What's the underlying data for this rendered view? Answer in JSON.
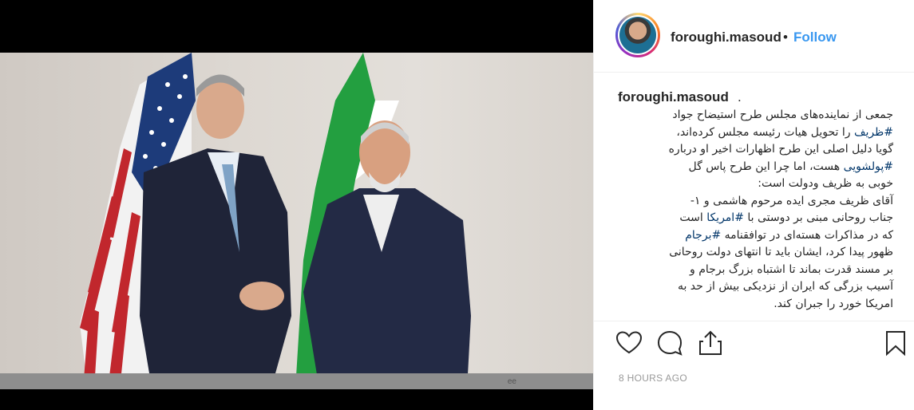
{
  "photo": {
    "watermark": "ee"
  },
  "header": {
    "username": "foroughi.masoud",
    "separator": "•",
    "follow_label": "Follow"
  },
  "caption": {
    "username": "foroughi.masoud",
    "trailing": ".",
    "lines": [
      "جمعی از نماینده‌های مجلس طرح استیضاح جواد",
      "#ظریف را تحویل هیات رئیسه مجلس کرده‌اند،",
      "گویا دلیل اصلی این طرح اظهارات اخیر او درباره",
      "#پولشویی هست، اما چرا این طرح پاس گل",
      "خوبی به ظریف ودولت است:",
      "آقای ظریف مجری ایده مرحوم هاشمی و ۱-",
      "جناب روحانی مبنی بر دوستی با #امریکا است",
      "که در مذاکرات هسته‌ای در توافقنامه  #برجام",
      "ظهور پیدا کرد، ایشان باید تا انتهای دولت روحانی",
      "بر مسند قدرت بماند تا اشتباه بزرگ برجام و",
      "آسیب بزرگی که ایران از نزدیکی بیش از حد به",
      "امریکا خورد را جبران کند."
    ]
  },
  "actions": {
    "like": "heart-icon",
    "comment": "comment-icon",
    "share": "share-icon",
    "save": "bookmark-icon"
  },
  "timestamp": "8 HOURS AGO",
  "colors": {
    "link": "#3897f0",
    "hashtag": "#003569",
    "text": "#262626",
    "muted": "#999999"
  }
}
